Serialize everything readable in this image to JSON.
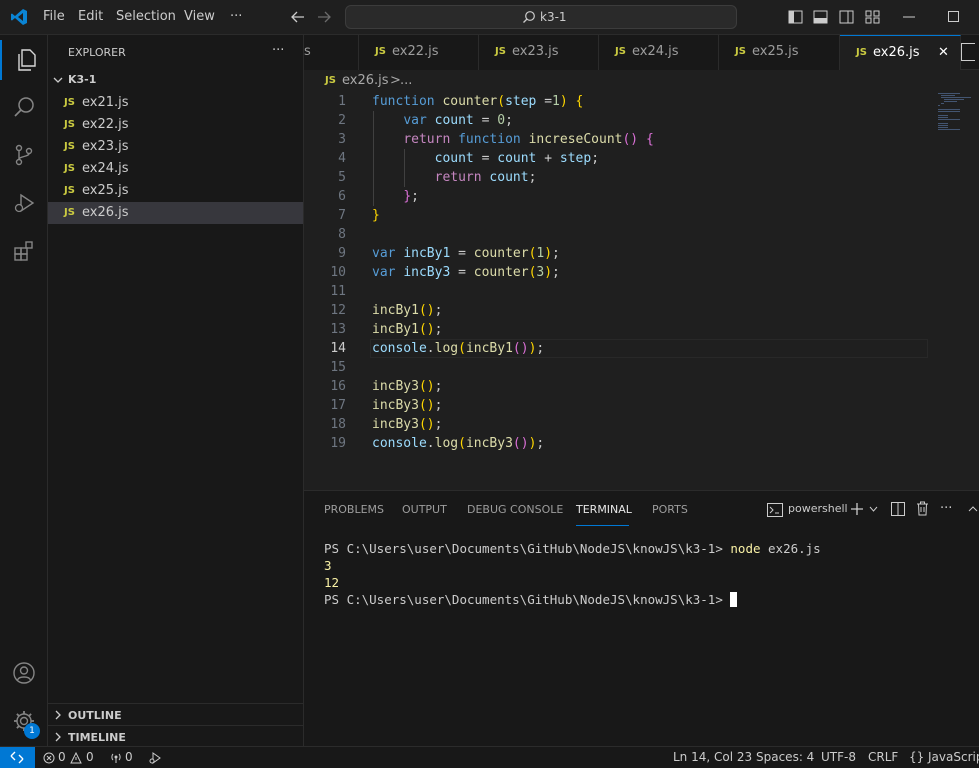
{
  "window": {
    "menu": [
      "File",
      "Edit",
      "Selection",
      "View",
      "···"
    ],
    "search_text": "k3-1"
  },
  "sidebar": {
    "title": "EXPLORER",
    "more": "···",
    "folder": "K3-1",
    "files": [
      {
        "name": "ex21.js",
        "badge": "JS"
      },
      {
        "name": "ex22.js",
        "badge": "JS"
      },
      {
        "name": "ex23.js",
        "badge": "JS"
      },
      {
        "name": "ex24.js",
        "badge": "JS"
      },
      {
        "name": "ex25.js",
        "badge": "JS"
      },
      {
        "name": "ex26.js",
        "badge": "JS"
      }
    ],
    "outline": "OUTLINE",
    "timeline": "TIMELINE"
  },
  "tabs": {
    "partial": "s",
    "items": [
      {
        "name": "ex22.js",
        "badge": "JS"
      },
      {
        "name": "ex23.js",
        "badge": "JS"
      },
      {
        "name": "ex24.js",
        "badge": "JS"
      },
      {
        "name": "ex25.js",
        "badge": "JS"
      },
      {
        "name": "ex26.js",
        "badge": "JS"
      }
    ],
    "close": "✕"
  },
  "breadcrumb": {
    "badge": "JS",
    "file": "ex26.js",
    "sep": ">",
    "rest": "..."
  },
  "editor": {
    "current_line": 14,
    "lines": [
      "1",
      "2",
      "3",
      "4",
      "5",
      "6",
      "7",
      "8",
      "9",
      "10",
      "11",
      "12",
      "13",
      "14",
      "15",
      "16",
      "17",
      "18",
      "19"
    ]
  },
  "panel": {
    "tabs": [
      "PROBLEMS",
      "OUTPUT",
      "DEBUG CONSOLE",
      "TERMINAL",
      "PORTS"
    ],
    "shell": "powershell",
    "prompt1": "PS C:\\Users\\user\\Documents\\GitHub\\NodeJS\\knowJS\\k3-1>",
    "cmd": "node",
    "arg": "ex26.js",
    "out1": "3",
    "out2": "12",
    "prompt2": "PS C:\\Users\\user\\Documents\\GitHub\\NodeJS\\knowJS\\k3-1>"
  },
  "status": {
    "errors": "0",
    "warnings": "0",
    "ports": "0",
    "position": "Ln 14, Col 23",
    "spaces": "Spaces: 4",
    "encoding": "UTF-8",
    "eol": "CRLF",
    "braces": "{}",
    "language": "JavaScript",
    "badge": "1"
  },
  "colors": {
    "accent": "#0078d4",
    "js_badge": "#cbcb41"
  }
}
